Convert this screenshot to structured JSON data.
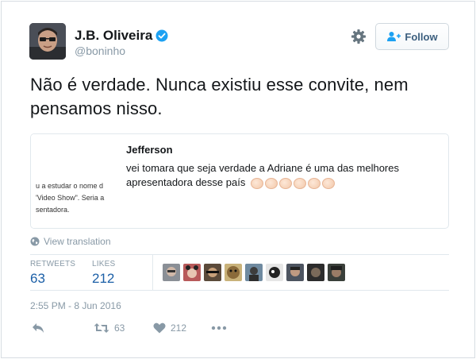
{
  "author": {
    "name": "J.B. Oliveira",
    "handle": "@boninho",
    "verified": true
  },
  "follow_button": {
    "label": "Follow"
  },
  "tweet": {
    "text": "Não é verdade. Nunca existiu esse convite, nem pensamos nisso."
  },
  "quoted": {
    "author": "Jefferson",
    "text": "vei tomara que seja verdade a Adriane é uma das melhores apresentadora desse país",
    "image_text_lines": [
      "u a estudar o nome d",
      "'Video Show\". Seria a",
      "sentadora."
    ]
  },
  "translation": {
    "label": "View translation"
  },
  "stats": {
    "retweets_label": "RETWEETS",
    "retweets_value": "63",
    "likes_label": "LIKES",
    "likes_value": "212"
  },
  "timestamp": "2:55 PM - 8 Jun 2016",
  "actions": {
    "retweet_count": "63",
    "like_count": "212"
  },
  "colors": {
    "link_blue": "#1b5fa7",
    "muted": "#8899a6",
    "verified": "#1da1f2"
  },
  "icons": [
    "gear-icon",
    "verified-badge-icon",
    "follow-user-icon",
    "globe-icon",
    "reply-icon",
    "retweet-icon",
    "heart-icon",
    "more-icon"
  ]
}
